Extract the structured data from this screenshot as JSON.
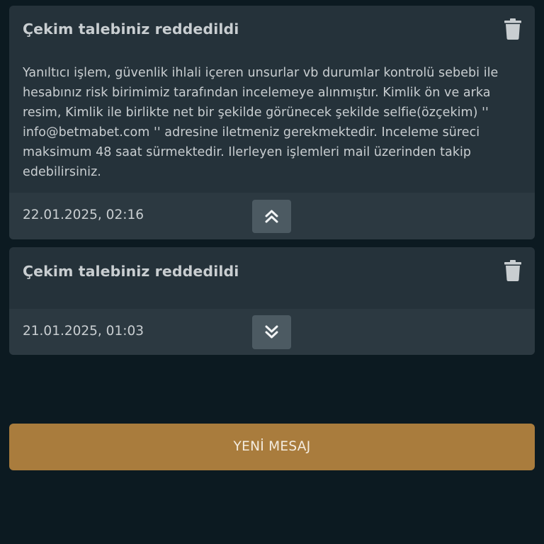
{
  "messages": [
    {
      "title": "Çekim talebiniz reddedildi",
      "body": "Yanıltıcı işlem, güvenlik ihlali içeren unsurlar vb durumlar kontrolü sebebi ile hesabınız risk birimimiz tarafından incelemeye alınmıştır. Kimlik ön ve arka resim, Kimlik ile birlikte net bir şekilde görünecek şekilde selfie(özçekim) '' info@betmabet.com '' adresine iletmeniz gerekmektedir. Inceleme süreci maksimum 48 saat sürmektedir. Ilerleyen işlemleri mail üzerinden takip edebilirsiniz.",
      "date": "22.01.2025, 02:16",
      "expanded": true,
      "delete_icon": "trash-icon",
      "toggle_icon": "chevrons-up-icon"
    },
    {
      "title": "Çekim talebiniz reddedildi",
      "date": "21.01.2025, 01:03",
      "expanded": false,
      "delete_icon": "trash-icon",
      "toggle_icon": "chevrons-down-icon"
    }
  ],
  "new_message_button": {
    "label": "YENİ MESAJ"
  },
  "colors": {
    "background": "#0c1a21",
    "card": "#25323a",
    "card_footer": "#2c3941",
    "toggle_button": "#4c5a62",
    "accent_button": "#a97c3d",
    "text": "#c9ced1"
  }
}
